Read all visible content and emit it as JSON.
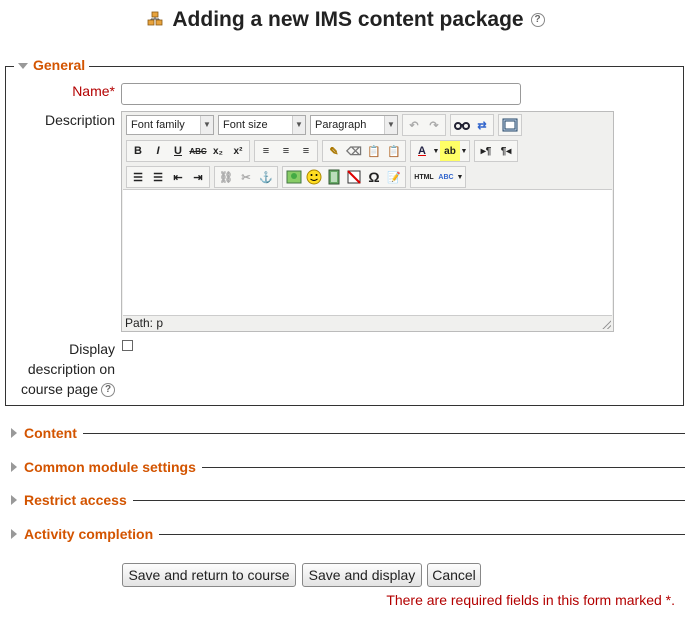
{
  "page": {
    "title": "Adding a new IMS content package"
  },
  "general": {
    "legend": "General",
    "name_label": "Name",
    "required_marker": "*",
    "name_value": "",
    "description_label": "Description",
    "display_label_line1": "Display",
    "display_label_line2": "description on",
    "display_label_line3": "course page"
  },
  "editor": {
    "font_family": "Font family",
    "font_size": "Font size",
    "format": "Paragraph",
    "path_label": "Path: p",
    "buttons": {
      "bold": "B",
      "italic": "I",
      "underline": "U",
      "strike": "ABC",
      "sub": "x₂",
      "sup": "x²",
      "html": "HTML",
      "omega": "Ω",
      "spell": "ABC"
    }
  },
  "sections": {
    "content": "Content",
    "common": "Common module settings",
    "restrict": "Restrict access",
    "completion": "Activity completion"
  },
  "actions": {
    "save_return": "Save and return to course",
    "save_display": "Save and display",
    "cancel": "Cancel"
  },
  "required_note": "There are required fields in this form marked *.",
  "colors": {
    "accent": "#d35400",
    "required": "#b30000"
  }
}
